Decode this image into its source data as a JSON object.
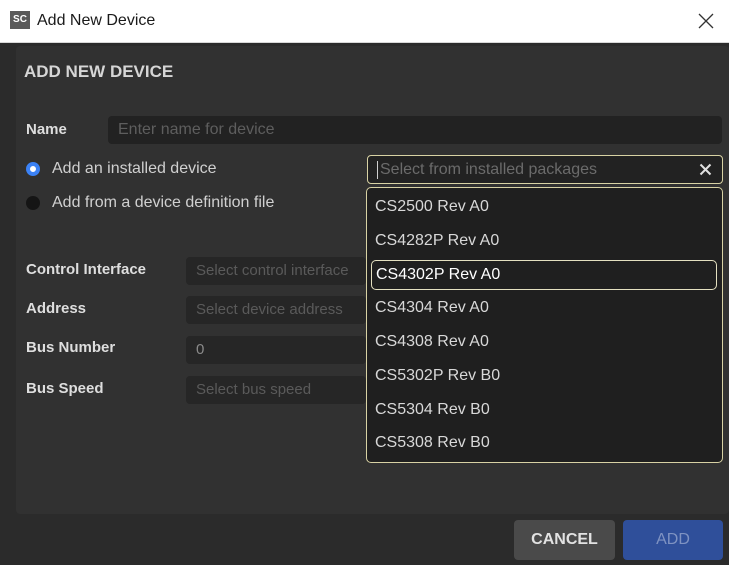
{
  "window": {
    "app_icon": "SC",
    "title": "Add New Device",
    "close_icon": "close-icon"
  },
  "dialog": {
    "heading": "ADD NEW DEVICE",
    "name": {
      "label": "Name",
      "placeholder": "Enter name for device"
    },
    "radio_options": [
      {
        "label": "Add an installed device",
        "checked": true
      },
      {
        "label": "Add from a device definition file",
        "checked": false
      }
    ],
    "package_select": {
      "placeholder": "Select from installed packages",
      "clear_icon": "clear-icon",
      "options": [
        "CS2500 Rev A0",
        "CS4282P Rev A0",
        "CS4302P Rev A0",
        "CS4304 Rev A0",
        "CS4308 Rev A0",
        "CS5302P Rev B0",
        "CS5304 Rev B0",
        "CS5308 Rev B0"
      ],
      "highlighted": "CS4302P Rev A0"
    },
    "control_interface": {
      "label": "Control Interface",
      "placeholder": "Select control interface"
    },
    "address": {
      "label": "Address",
      "placeholder": "Select device address"
    },
    "bus_number": {
      "label": "Bus Number",
      "value": "0"
    },
    "bus_speed": {
      "label": "Bus Speed",
      "placeholder": "Select bus speed"
    }
  },
  "buttons": {
    "cancel": "CANCEL",
    "add": "ADD"
  },
  "colors": {
    "background": "#2b2b2b",
    "accent_border": "#d8d2a4",
    "radio_checked": "#3b82f6",
    "add_button": "#2f4f9a"
  }
}
